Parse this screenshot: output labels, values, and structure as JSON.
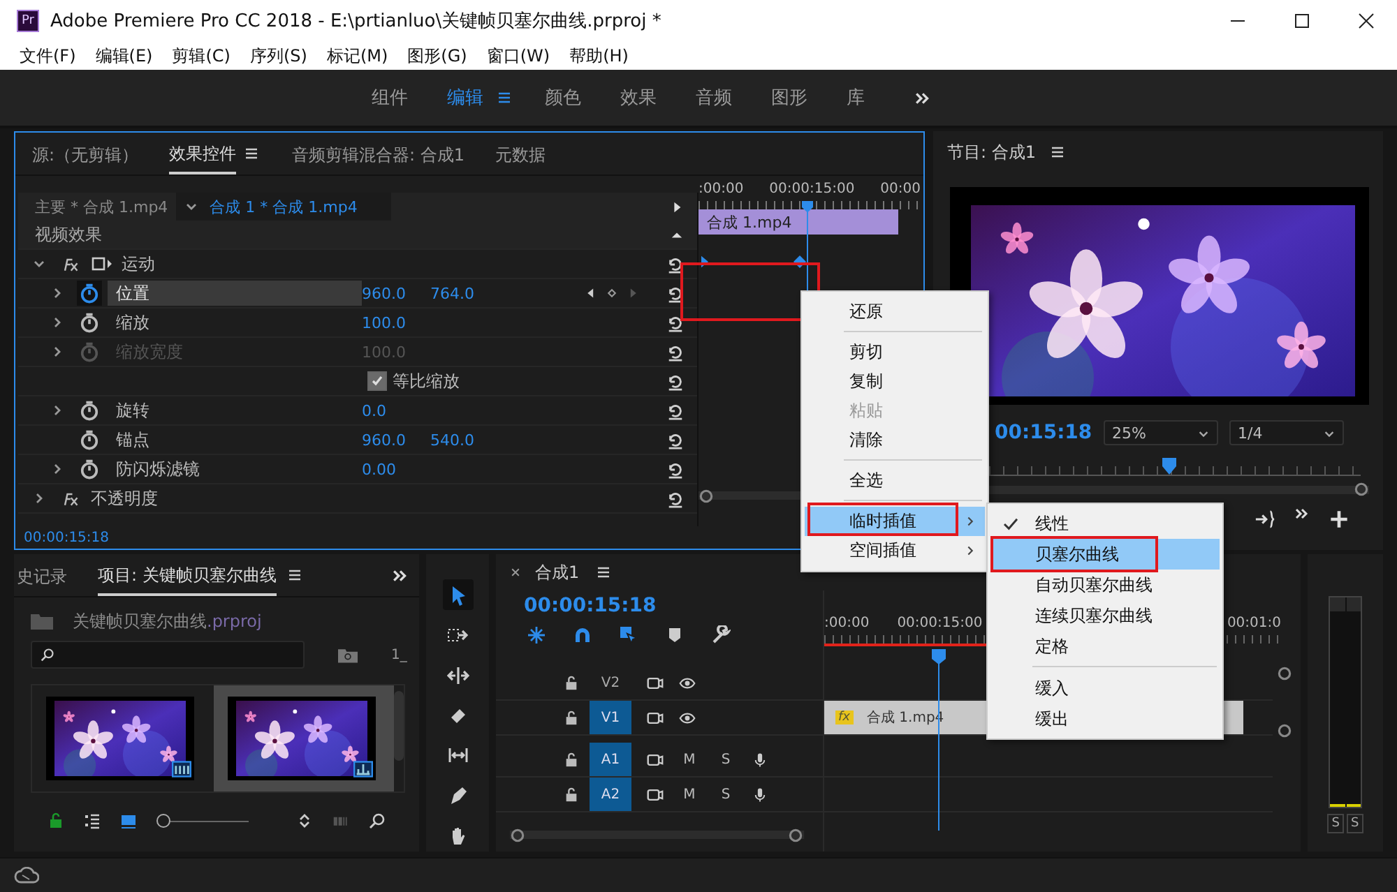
{
  "window": {
    "title": "Adobe Premiere Pro CC 2018 - E:\\prtianluo\\关键帧贝塞尔曲线.prproj *",
    "app_badge": "Pr"
  },
  "menu_bar": [
    "文件(F)",
    "编辑(E)",
    "剪辑(C)",
    "序列(S)",
    "标记(M)",
    "图形(G)",
    "窗口(W)",
    "帮助(H)"
  ],
  "workspaces": [
    {
      "label": "组件",
      "selected": false
    },
    {
      "label": "编辑",
      "selected": true
    },
    {
      "label": "颜色",
      "selected": false
    },
    {
      "label": "效果",
      "selected": false
    },
    {
      "label": "音频",
      "selected": false
    },
    {
      "label": "图形",
      "selected": false
    },
    {
      "label": "库",
      "selected": false
    }
  ],
  "effect_controls": {
    "tabs": [
      {
        "label": "源:（无剪辑）",
        "selected": false
      },
      {
        "label": "效果控件",
        "selected": true
      },
      {
        "label": "音频剪辑混合器: 合成1",
        "selected": false
      },
      {
        "label": "元数据",
        "selected": false
      }
    ],
    "clip_tabs": [
      {
        "label": "主要 * 合成 1.mp4",
        "selected": false
      },
      {
        "label": "合成 1 * 合成 1.mp4",
        "selected": true
      }
    ],
    "section": "视频效果",
    "effects": [
      {
        "kind": "motion",
        "name": "运动",
        "expanded": true,
        "children": [
          {
            "kind": "property",
            "name": "位置",
            "values": [
              "960.0",
              "764.0"
            ],
            "expandable": true,
            "animated": true,
            "selected": true,
            "disabled": false
          },
          {
            "kind": "property",
            "name": "缩放",
            "values": [
              "100.0"
            ],
            "expandable": true,
            "animated": false,
            "selected": false,
            "disabled": false
          },
          {
            "kind": "property",
            "name": "缩放宽度",
            "values": [
              "100.0"
            ],
            "expandable": true,
            "animated": false,
            "selected": false,
            "disabled": true
          },
          {
            "kind": "checkbox",
            "name": "等比缩放",
            "checked": true
          },
          {
            "kind": "property",
            "name": "旋转",
            "values": [
              "0.0"
            ],
            "expandable": true,
            "animated": false,
            "selected": false,
            "disabled": false
          },
          {
            "kind": "property",
            "name": "锚点",
            "values": [
              "960.0",
              "540.0"
            ],
            "expandable": false,
            "animated": false,
            "selected": false,
            "disabled": false
          },
          {
            "kind": "property",
            "name": "防闪烁滤镜",
            "values": [
              "0.00"
            ],
            "expandable": true,
            "animated": false,
            "selected": false,
            "disabled": false
          }
        ]
      },
      {
        "kind": "opacity",
        "name": "不透明度",
        "expanded": false
      }
    ],
    "timeline": {
      "ruler_labels": [
        ":00:00",
        "00:00:15:00",
        "00:00"
      ],
      "clip": "合成 1.mp4",
      "annotated": true
    },
    "timecode": "00:00:15:18"
  },
  "program_monitor": {
    "title": "节目: 合成1",
    "timecode": "00:15:18",
    "zoom": "25%",
    "resolution": "1/4"
  },
  "context_menu": {
    "items": [
      {
        "kind": "item",
        "label": "还原",
        "disabled": false,
        "selected": false,
        "annotated": false
      },
      {
        "kind": "separator"
      },
      {
        "kind": "item",
        "label": "剪切",
        "disabled": false,
        "selected": false,
        "annotated": false
      },
      {
        "kind": "item",
        "label": "复制",
        "disabled": false,
        "selected": false,
        "annotated": false
      },
      {
        "kind": "item",
        "label": "粘贴",
        "disabled": true,
        "selected": false,
        "annotated": false
      },
      {
        "kind": "item",
        "label": "清除",
        "disabled": false,
        "selected": false,
        "annotated": false
      },
      {
        "kind": "separator"
      },
      {
        "kind": "item",
        "label": "全选",
        "disabled": false,
        "selected": false,
        "annotated": false
      },
      {
        "kind": "separator"
      },
      {
        "kind": "submenu",
        "label": "临时插值",
        "disabled": false,
        "selected": true,
        "annotated": true
      },
      {
        "kind": "submenu",
        "label": "空间插值",
        "disabled": false,
        "selected": false,
        "annotated": false
      }
    ]
  },
  "submenu": {
    "items": [
      {
        "kind": "item",
        "label": "线性",
        "checked": true,
        "selected": false,
        "annotated": false
      },
      {
        "kind": "item",
        "label": "贝塞尔曲线",
        "checked": false,
        "selected": true,
        "annotated": true
      },
      {
        "kind": "item",
        "label": "自动贝塞尔曲线",
        "checked": false,
        "selected": false,
        "annotated": false
      },
      {
        "kind": "item",
        "label": "连续贝塞尔曲线",
        "checked": false,
        "selected": false,
        "annotated": false
      },
      {
        "kind": "item",
        "label": "定格",
        "checked": false,
        "selected": false,
        "annotated": false
      },
      {
        "kind": "separator"
      },
      {
        "kind": "item",
        "label": "缓入",
        "checked": false,
        "selected": false,
        "annotated": false
      },
      {
        "kind": "item",
        "label": "缓出",
        "checked": false,
        "selected": false,
        "annotated": false
      }
    ]
  },
  "project": {
    "tabs": [
      {
        "label": "史记录",
        "selected": false
      },
      {
        "label": "项目: 关键帧贝塞尔曲线",
        "selected": true
      }
    ],
    "file_name": "关键帧贝塞尔曲线",
    "file_ext": ".prproj",
    "item_count": "1_",
    "items": [
      {
        "kind": "clip",
        "selected": false
      },
      {
        "kind": "sequence",
        "selected": true
      }
    ],
    "thumbnail_zoom": {
      "level": 0
    }
  },
  "tools": [
    {
      "kind": "selection",
      "selected": true
    },
    {
      "kind": "track-select",
      "selected": false
    },
    {
      "kind": "ripple",
      "selected": false
    },
    {
      "kind": "razor",
      "selected": false
    },
    {
      "kind": "slip",
      "selected": false
    },
    {
      "kind": "pen",
      "selected": false
    },
    {
      "kind": "hand",
      "selected": false
    }
  ],
  "timeline": {
    "title": "合成1",
    "timecode": "00:00:15:18",
    "ruler_labels": [
      ":00:00",
      "00:00:15:00",
      "00:01:0"
    ],
    "tracks": [
      {
        "kind": "video",
        "name": "V2",
        "targeted": false
      },
      {
        "kind": "video",
        "name": "V1",
        "targeted": true,
        "clip": "合成 1.mp4",
        "clip_badge": "fx"
      },
      {
        "kind": "audio",
        "name": "A1",
        "targeted": true,
        "mute": "M",
        "solo": "S"
      },
      {
        "kind": "audio",
        "name": "A2",
        "targeted": true,
        "mute": "M",
        "solo": "S"
      }
    ]
  },
  "audio_meter": {
    "solo_buttons": [
      "S",
      "S"
    ]
  }
}
